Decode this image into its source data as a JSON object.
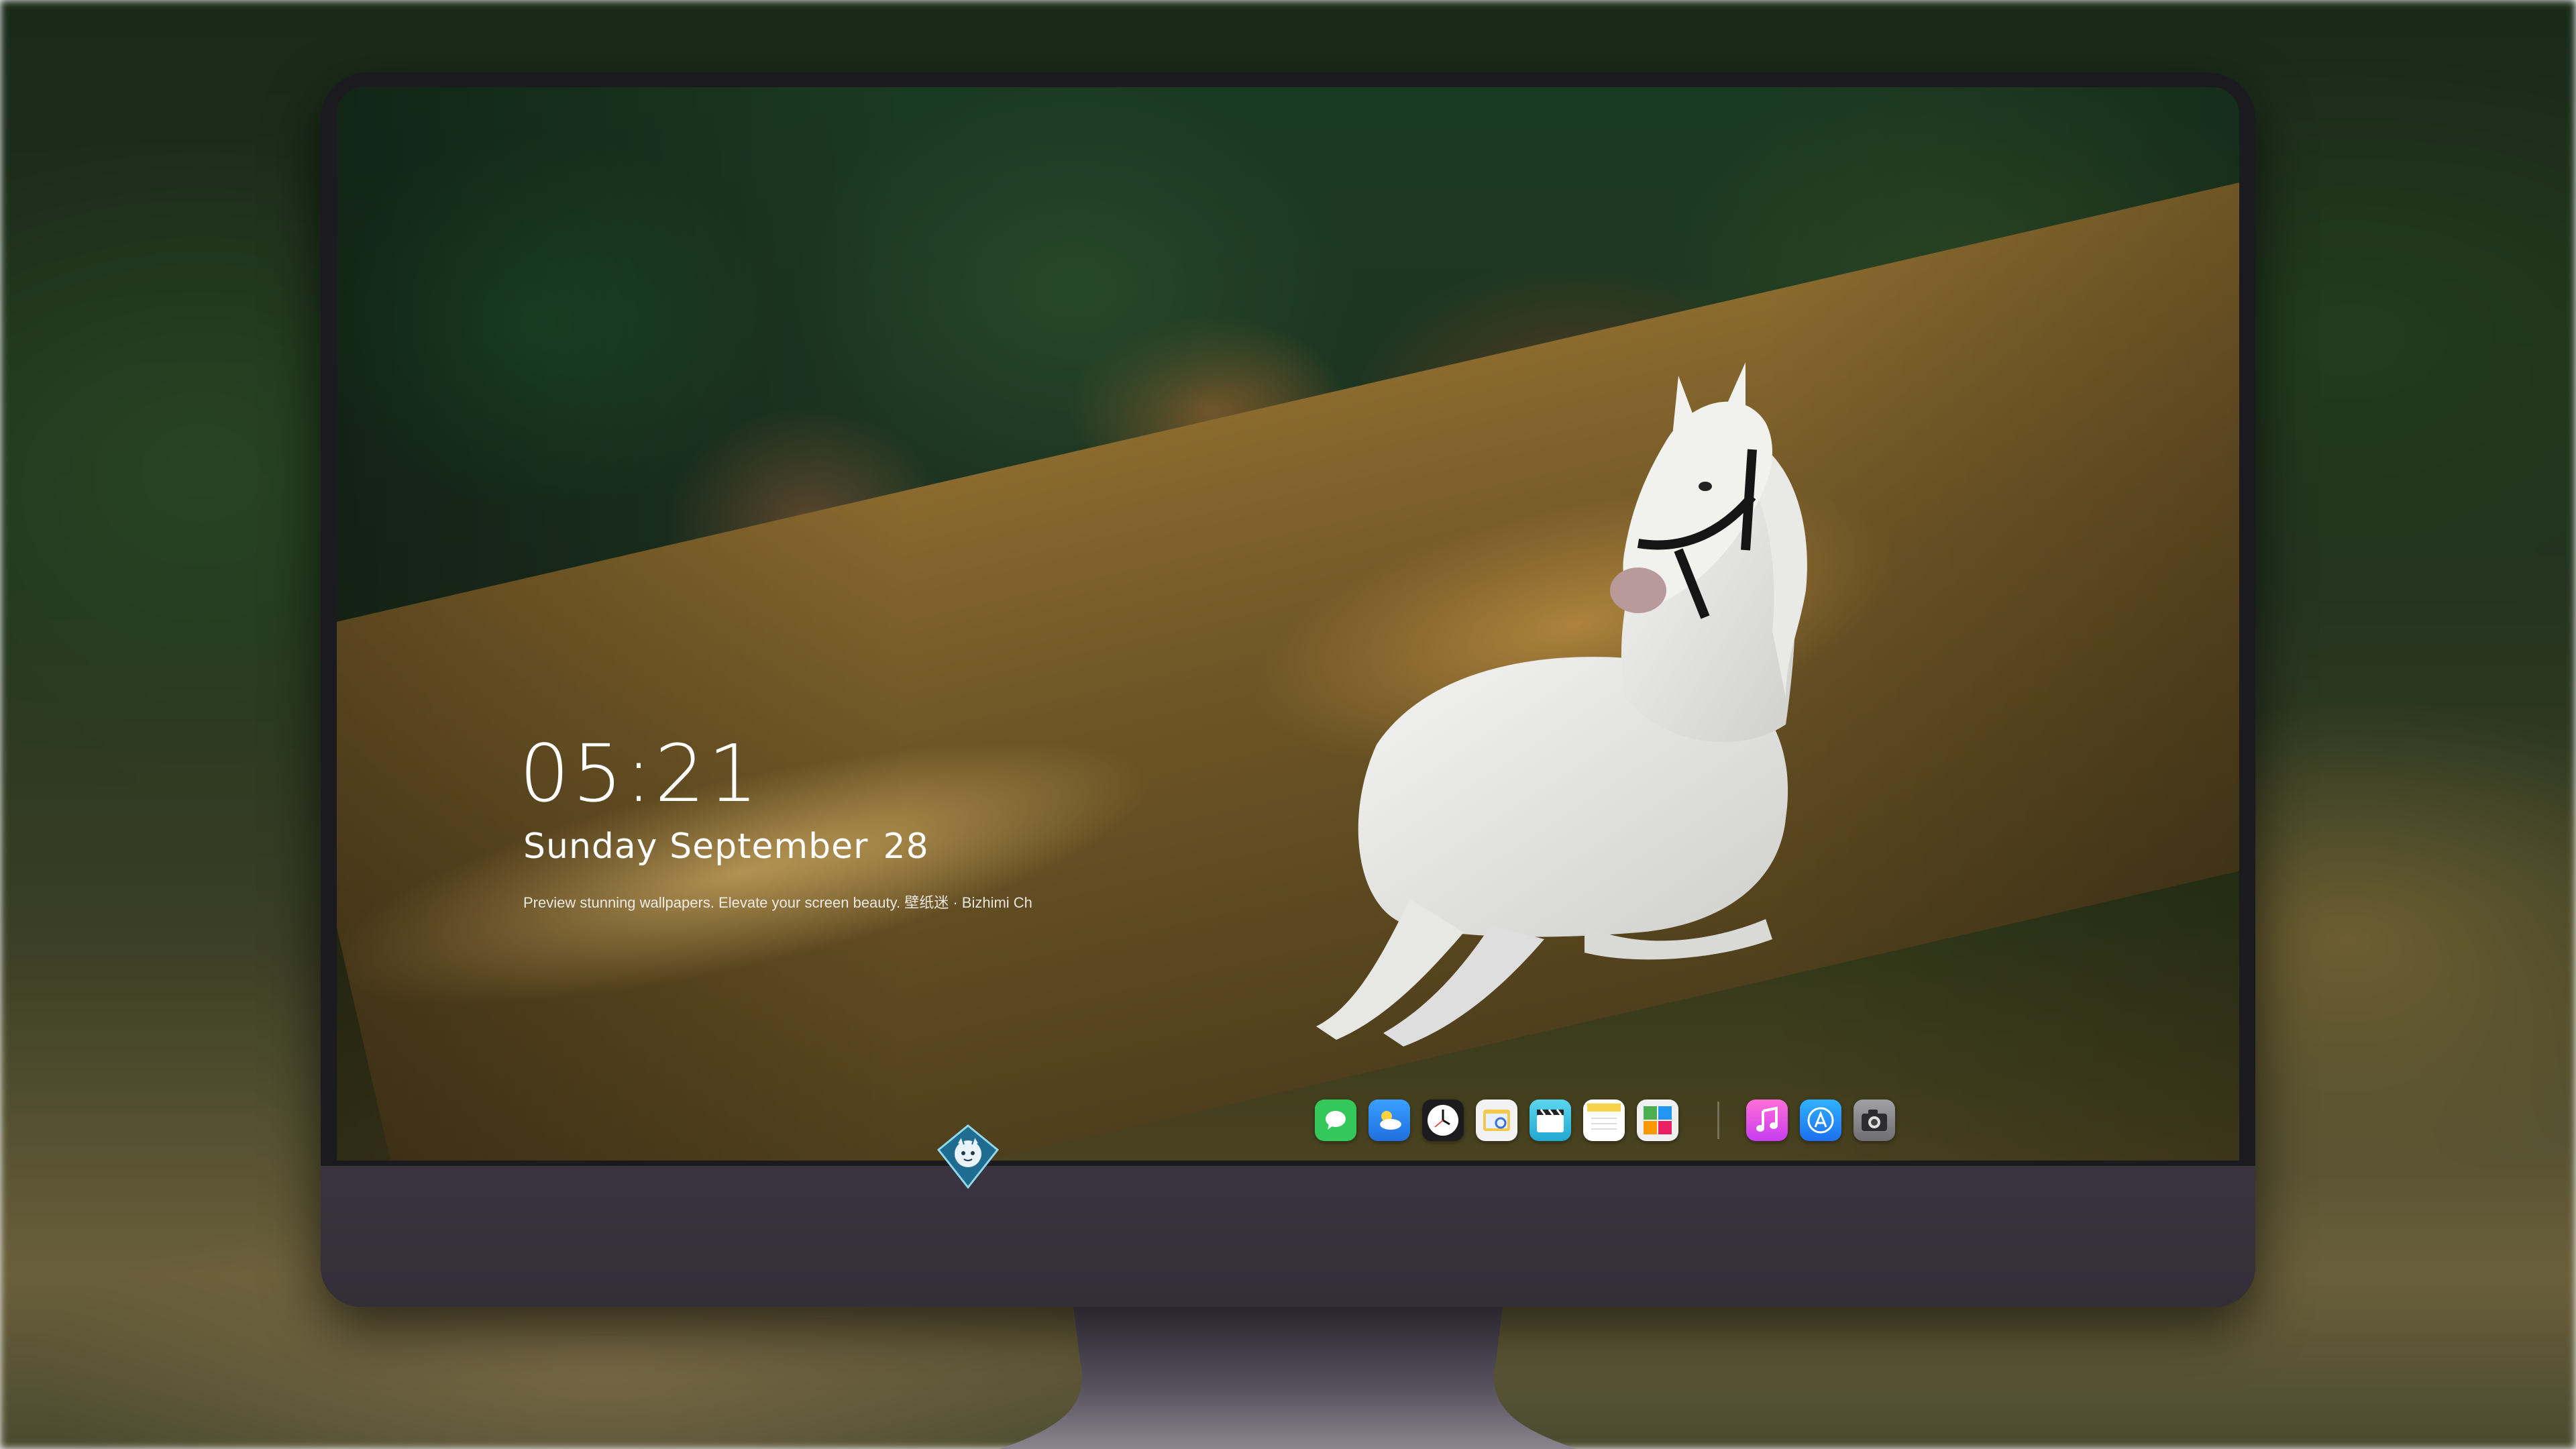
{
  "lockscreen": {
    "time": "05:21",
    "weekday_month": "Sunday September",
    "day": "28",
    "tagline": "Preview stunning wallpapers. Elevate your screen beauty. 壁纸迷 · Bizhimi Ch"
  },
  "dock": {
    "group1": [
      {
        "icon": "messages-icon",
        "color": "#34c759"
      },
      {
        "icon": "weather-icon",
        "color": "#2f8ef4"
      },
      {
        "icon": "clock-icon",
        "color": "#ffffff"
      },
      {
        "icon": "preview-icon",
        "color": "#f2c94c"
      },
      {
        "icon": "clips-icon",
        "color": "#36c3e0"
      },
      {
        "icon": "notes-icon",
        "color": "#f7d24a"
      },
      {
        "icon": "photo-booth-icon",
        "color": "#e8e8e8"
      }
    ],
    "group2": [
      {
        "icon": "music-icon",
        "color": "#fb5ce0"
      },
      {
        "icon": "app-store-icon",
        "color": "#1c8ef9"
      },
      {
        "icon": "camera-icon",
        "color": "#8e8e93"
      }
    ]
  },
  "monitor": {
    "logo": "mascot-logo-icon"
  }
}
